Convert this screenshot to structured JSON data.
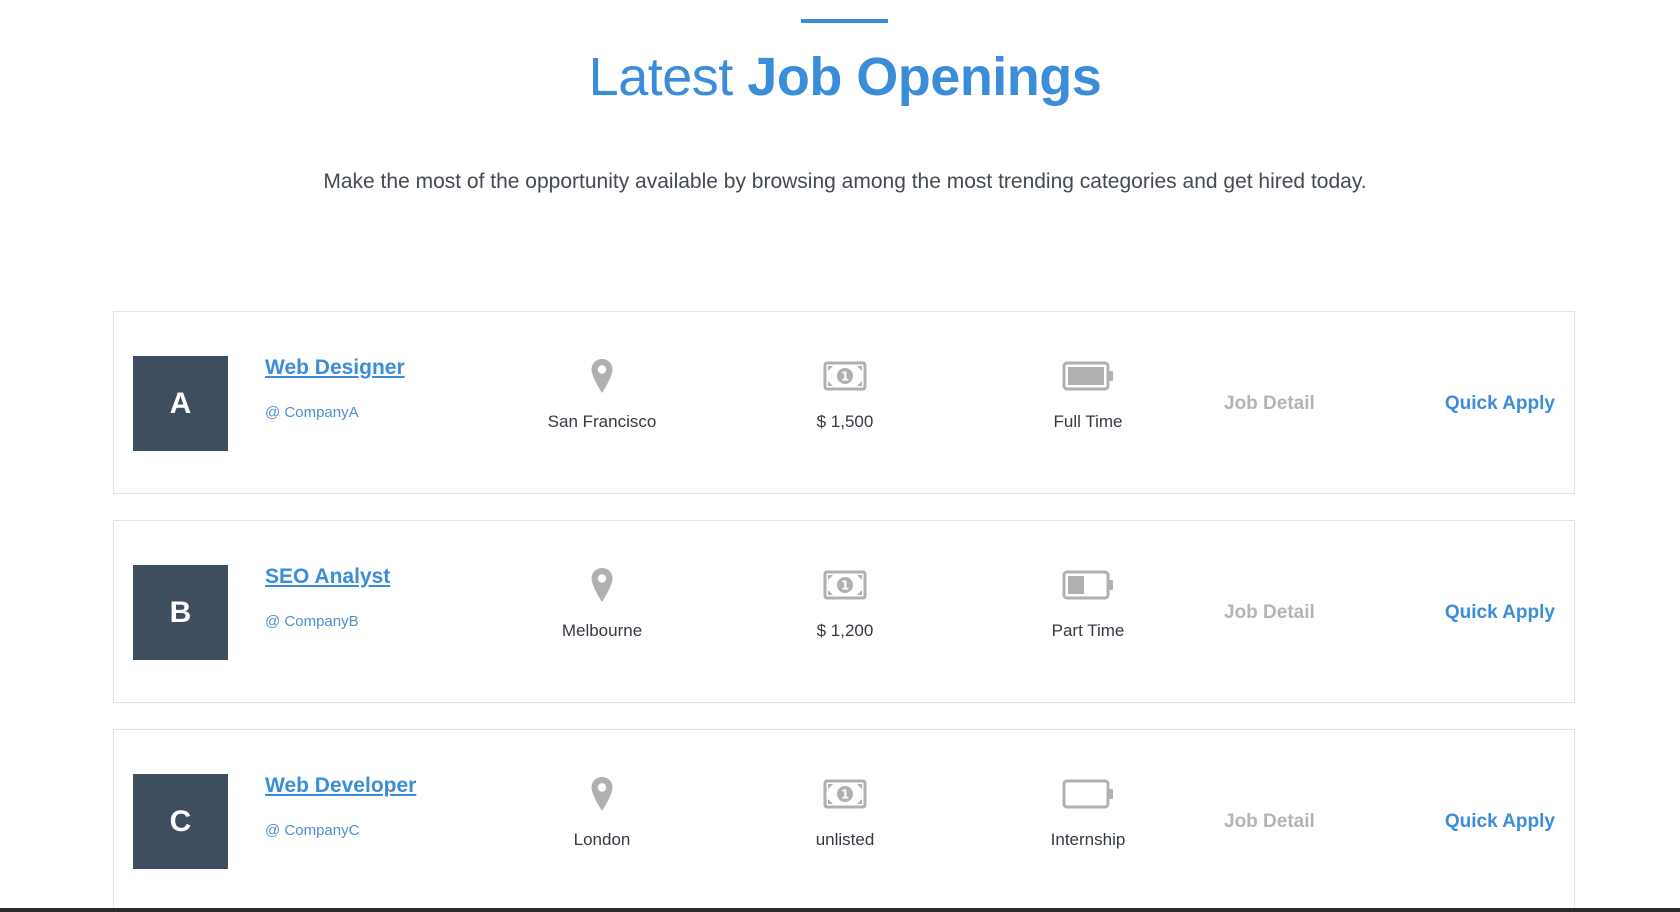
{
  "section": {
    "heading_light": "Latest",
    "heading_bold": "Job Openings",
    "subtitle": "Make the most of the opportunity available by browsing among the most trending categories and get hired today."
  },
  "colors": {
    "accent": "#3c8dd9",
    "logo_bg": "#3e4e5e",
    "icon_gray": "#b0b0b0",
    "muted_link": "#b4b4b4"
  },
  "icons": {
    "location": "map-pin-icon",
    "salary": "banknote-icon",
    "type": "battery-icon"
  },
  "jobs": [
    {
      "logo_letter": "A",
      "title": "Web Designer",
      "company": "@ CompanyA",
      "location": "San Francisco",
      "salary": "$ 1,500",
      "type": "Full Time",
      "type_level": 1.0,
      "detail_label": "Job Detail",
      "apply_label": "Quick Apply"
    },
    {
      "logo_letter": "B",
      "title": "SEO Analyst",
      "company": "@ CompanyB",
      "location": "Melbourne",
      "salary": "$ 1,200",
      "type": "Part Time",
      "type_level": 0.4,
      "detail_label": "Job Detail",
      "apply_label": "Quick Apply"
    },
    {
      "logo_letter": "C",
      "title": "Web Developer",
      "company": "@ CompanyC",
      "location": "London",
      "salary": "unlisted",
      "type": "Internship",
      "type_level": 0.0,
      "detail_label": "Job Detail",
      "apply_label": "Quick Apply"
    }
  ]
}
